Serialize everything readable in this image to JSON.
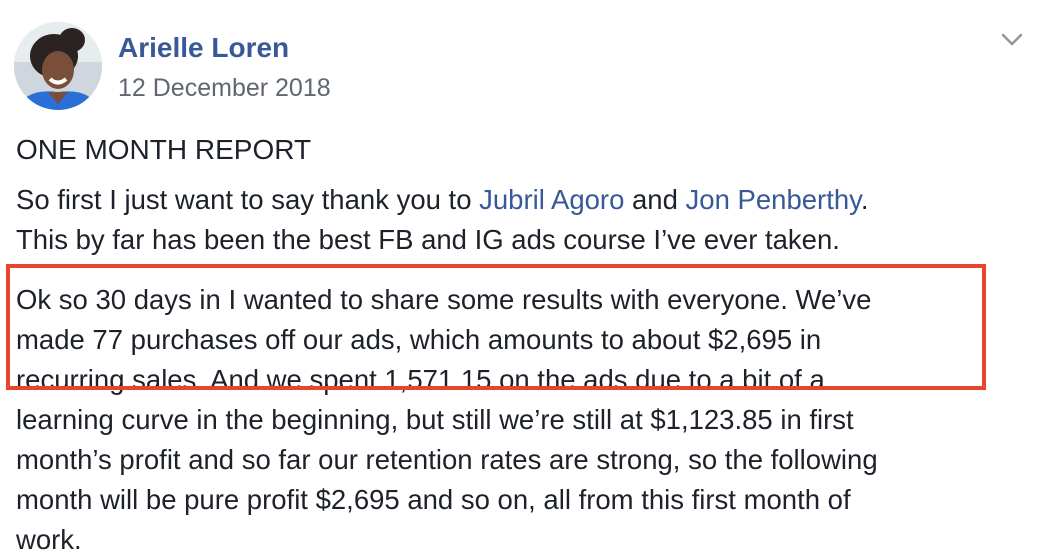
{
  "post": {
    "author": "Arielle Loren",
    "date": "12 December 2018",
    "title": "ONE MONTH REPORT",
    "p1": {
      "l1_a": "So first I just want to say thank you to ",
      "l1_link1": "Jubril Agoro",
      "l1_b": " and ",
      "l1_link2": "Jon Penberthy",
      "l1_c": ".",
      "l2": "This by far has been the best FB and IG ads course I’ve ever taken."
    },
    "p2": {
      "lines": [
        "Ok so 30 days in I wanted to share some results with everyone. We’ve",
        "made 77 purchases off our ads, which amounts to about $2,695 in",
        "recurring sales. And we spent 1,571.15 on the ads due to a bit of a",
        "learning curve in the beginning, but still we’re still at $1,123.85 in first",
        "month’s profit and so far our retention rates are strong, so the following",
        "month will be pure profit $2,695 and so on, all from this first month of",
        "work."
      ]
    },
    "icons": {
      "menu": "chevron-down-icon",
      "avatar": "avatar"
    },
    "colors": {
      "link": "#385898",
      "highlight_border": "#e8442e",
      "meta": "#606770"
    }
  }
}
